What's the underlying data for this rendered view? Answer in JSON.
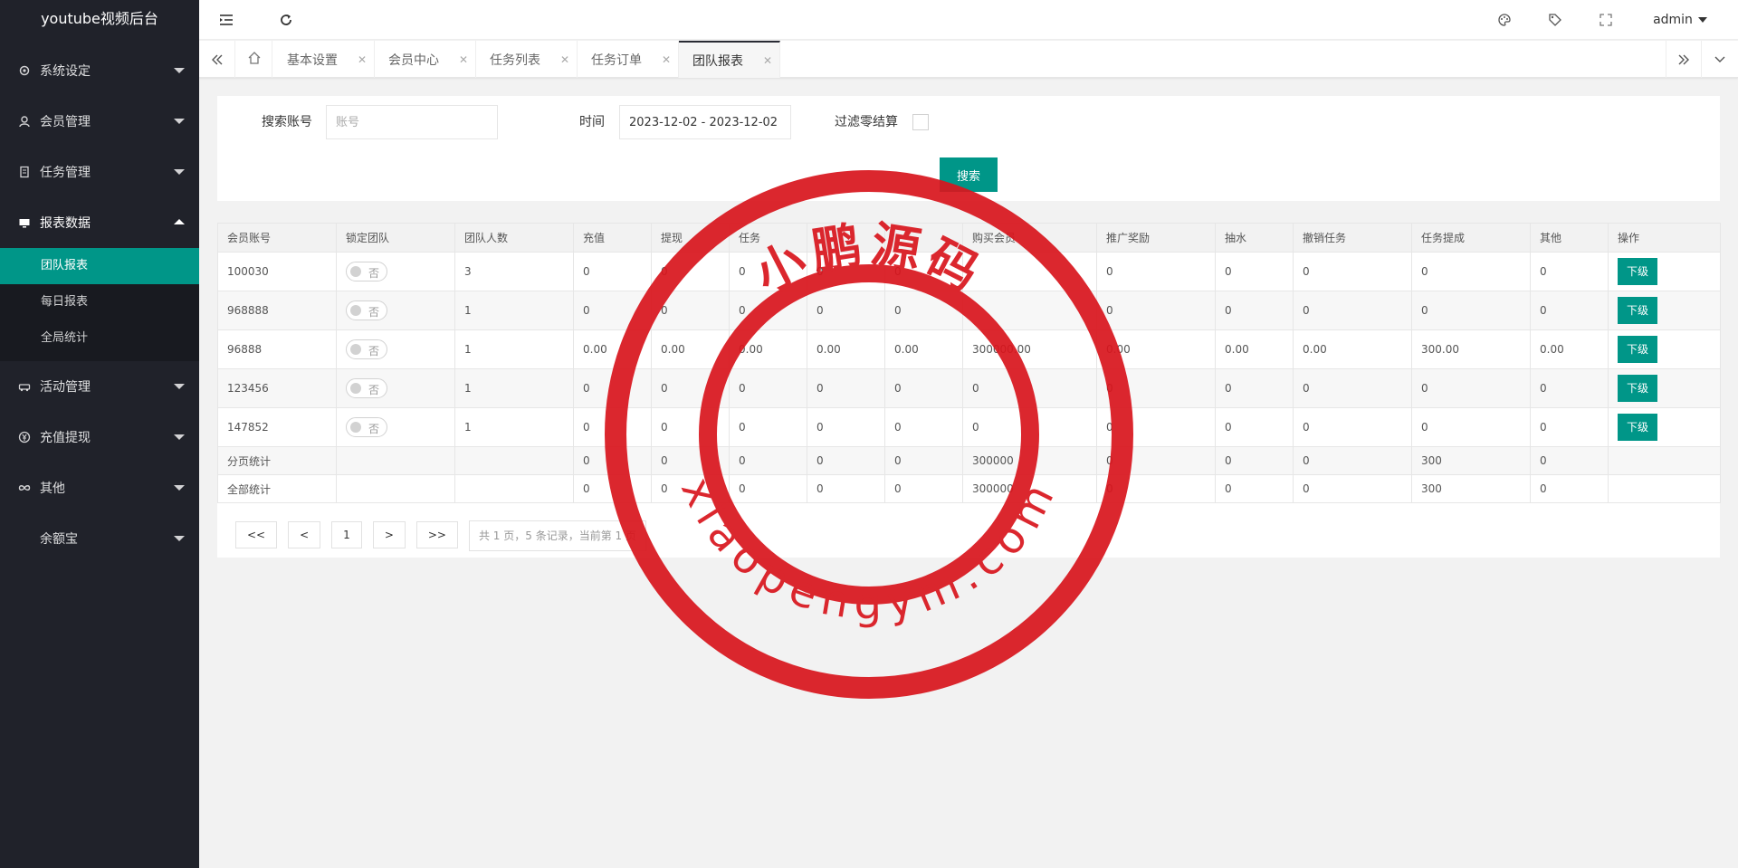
{
  "sidebar": {
    "title": "youtube视频后台",
    "items": [
      {
        "label": "系统设定"
      },
      {
        "label": "会员管理"
      },
      {
        "label": "任务管理"
      },
      {
        "label": "报表数据"
      },
      {
        "label": "活动管理"
      },
      {
        "label": "充值提现"
      },
      {
        "label": "其他"
      },
      {
        "label": "余额宝"
      }
    ],
    "report_sub": [
      "团队报表",
      "每日报表",
      "全局统计"
    ]
  },
  "header": {
    "user": "admin"
  },
  "tabs": [
    {
      "label": "基本设置"
    },
    {
      "label": "会员中心"
    },
    {
      "label": "任务列表"
    },
    {
      "label": "任务订单"
    },
    {
      "label": "团队报表"
    }
  ],
  "search": {
    "account_label": "搜索账号",
    "account_placeholder": "账号",
    "time_label": "时间",
    "time_value": "2023-12-02 - 2023-12-02",
    "filter_label": "过滤零结算",
    "button": "搜索"
  },
  "table": {
    "headers": [
      "会员账号",
      "锁定团队",
      "团队人数",
      "充值",
      "提现",
      "任务",
      "",
      "",
      "购买会员",
      "推广奖励",
      "抽水",
      "撤销任务",
      "任务提成",
      "其他",
      "操作"
    ],
    "rows": [
      [
        "100030",
        "否",
        "3",
        "0",
        "0",
        "0",
        "0",
        "0",
        "",
        "0",
        "0",
        "0",
        "0",
        "0"
      ],
      [
        "968888",
        "否",
        "1",
        "0",
        "0",
        "0",
        "0",
        "0",
        "",
        "0",
        "0",
        "0",
        "0",
        "0"
      ],
      [
        "96888",
        "否",
        "1",
        "0.00",
        "0.00",
        "0.00",
        "0.00",
        "0.00",
        "300000.00",
        "0.00",
        "0.00",
        "0.00",
        "300.00",
        "0.00"
      ],
      [
        "123456",
        "否",
        "1",
        "0",
        "0",
        "0",
        "0",
        "0",
        "0",
        "0",
        "0",
        "0",
        "0",
        "0"
      ],
      [
        "147852",
        "否",
        "1",
        "0",
        "0",
        "0",
        "0",
        "0",
        "0",
        "0",
        "0",
        "0",
        "0",
        "0"
      ]
    ],
    "action_label": "下级",
    "page_sum": [
      "分页统计",
      "",
      "",
      "0",
      "0",
      "0",
      "0",
      "0",
      "300000",
      "0",
      "0",
      "0",
      "300",
      "0",
      ""
    ],
    "total_sum": [
      "全部统计",
      "",
      "",
      "0",
      "0",
      "0",
      "0",
      "0",
      "300000",
      "0",
      "0",
      "0",
      "300",
      "0",
      ""
    ]
  },
  "pager": {
    "first": "<<",
    "prev": "<",
    "page": "1",
    "next": ">",
    "last": ">>",
    "info": "共 1 页，5 条记录，当前第 1 页"
  },
  "watermark": {
    "title": "小鹏源码",
    "url": "xiaopengym.com"
  },
  "colors": {
    "sidebar": "#20222a",
    "accent": "#009688",
    "stamp": "#d9151d"
  }
}
